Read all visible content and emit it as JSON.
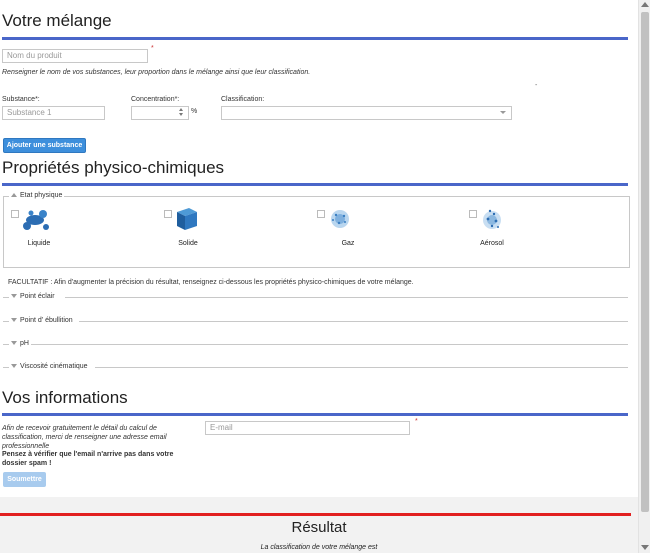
{
  "mix": {
    "title": "Votre mélange",
    "product_placeholder": "Nom du produit",
    "required_star": "*",
    "instructions": "Renseigner le nom de vos substances, leur proportion dans le mélange ainsi que leur classification.",
    "stray_mark": "-",
    "substance_label": "Substance*:",
    "substance_placeholder": "Substance 1",
    "concentration_label": "Concentration*:",
    "concentration_unit": "%",
    "classification_label": "Classification:",
    "classification_value": "",
    "add_button": "Ajouter une substance"
  },
  "physico": {
    "title": "Propriétés physico-chimiques",
    "etat_legend": "Etat physique",
    "states": [
      {
        "label": "Liquide",
        "icon": "liquid-icon"
      },
      {
        "label": "Solide",
        "icon": "solid-cube-icon"
      },
      {
        "label": "Gaz",
        "icon": "gas-icon"
      },
      {
        "label": "Aérosol",
        "icon": "aerosol-icon"
      }
    ],
    "optional_note": "FACULTATIF : Afin d'augmenter la précision du résultat, renseignez ci-dessous les propriétés physico-chimiques de votre mélange.",
    "sections": [
      "Point éclair",
      "Point d' ébullition",
      "pH",
      "Viscosité cinématique"
    ]
  },
  "info": {
    "title": "Vos informations",
    "description": "Afin de recevoir gratuitement le détail du calcul de classification, merci de renseigner une adresse email professionnelle",
    "warning": "Pensez à vérifier que l'email n'arrive pas dans votre dossier spam !",
    "email_placeholder": "E-mail",
    "submit_button": "Soumettre"
  },
  "result": {
    "title": "Résultat",
    "text": "La classification de votre mélange est"
  },
  "colors": {
    "section_rule": "#4a66c9",
    "result_rule": "#e22020",
    "button": "#3d8fdc"
  }
}
